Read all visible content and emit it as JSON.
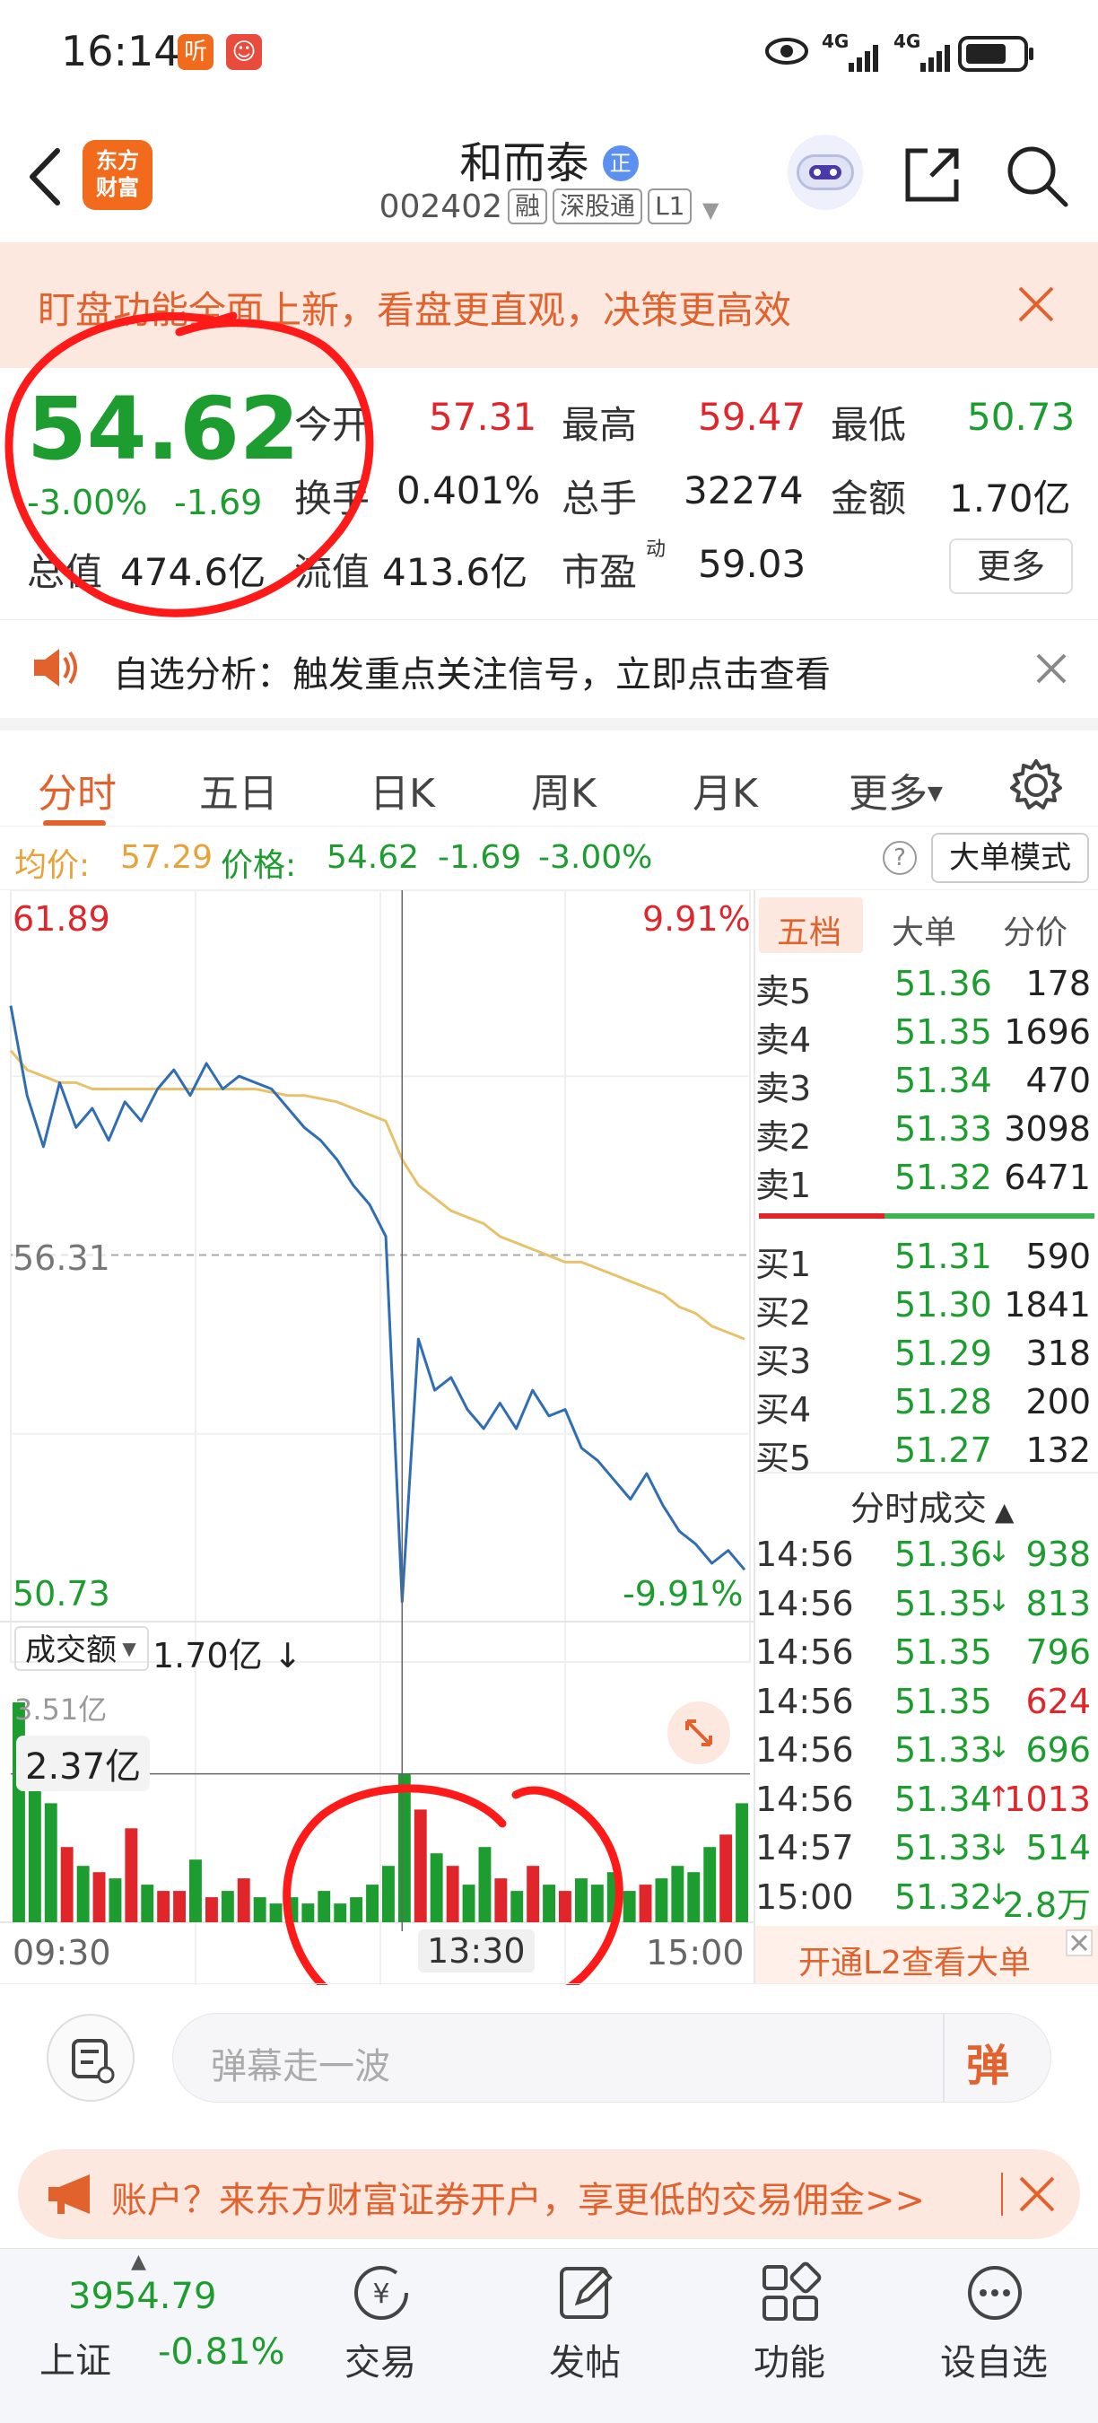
{
  "status_bar": {
    "time": "16:14",
    "badge1": "听",
    "net1": "4G",
    "net2": "4G"
  },
  "header": {
    "title": "和而泰",
    "title_badge": "正",
    "code": "002402",
    "tags": [
      "融",
      "深股通",
      "L1"
    ],
    "logo_line1": "东方",
    "logo_line2": "财富"
  },
  "banner": {
    "text": "盯盘功能全面上新，看盘更直观，决策更高效"
  },
  "quote": {
    "price": "54.62",
    "change_pct": "-3.00%",
    "change_amt": "-1.69",
    "total_value_label": "总值",
    "total_value": "474.6亿",
    "open_label": "今开",
    "open": "57.31",
    "high_label": "最高",
    "high": "59.47",
    "low_label": "最低",
    "low": "50.73",
    "turnover_label": "换手",
    "turnover": "0.401%",
    "volume_label": "总手",
    "volume": "32274",
    "amount_label": "金额",
    "amount": "1.70亿",
    "float_label": "流值",
    "float_value": "413.6亿",
    "pe_label": "市盈",
    "pe_sup": "动",
    "pe": "59.03",
    "more": "更多"
  },
  "analysis": {
    "text": "自选分析：触发重点关注信号，立即点击查看"
  },
  "tabs": [
    "分时",
    "五日",
    "日K",
    "周K",
    "月K",
    "更多"
  ],
  "info": {
    "avg_label": "均价:",
    "avg": "57.29",
    "price_label": "价格:",
    "price": "54.62",
    "chg": "-1.69",
    "pct": "-3.00%",
    "help": "?",
    "big_mode": "大单模式"
  },
  "chart_labels": {
    "top_price": "61.89",
    "top_pct": "9.91%",
    "mid_price": "56.31",
    "bottom_price": "50.73",
    "bottom_pct": "-9.91%",
    "vol_label": "成交额",
    "vol_value": "1.70亿",
    "vol_max": "3.51亿",
    "vol_cursor": "2.37亿",
    "t_start": "09:30",
    "t_mid": "13:30",
    "t_end": "15:00"
  },
  "chart_data": {
    "type": "line",
    "x_range": [
      "09:30",
      "15:00"
    ],
    "ylim": [
      50.73,
      61.89
    ],
    "ref_price": 56.31,
    "series": [
      {
        "name": "价格",
        "values": [
          60.2,
          58.8,
          58.0,
          59.0,
          58.3,
          58.6,
          58.1,
          58.7,
          58.4,
          58.9,
          59.2,
          58.8,
          59.3,
          58.9,
          59.1,
          59.0,
          58.9,
          58.6,
          58.3,
          58.1,
          57.8,
          57.4,
          57.1,
          56.6,
          50.9,
          55.0,
          54.2,
          54.4,
          53.9,
          53.6,
          54.0,
          53.6,
          54.2,
          53.8,
          53.9,
          53.3,
          53.1,
          52.8,
          52.5,
          52.9,
          52.4,
          52.0,
          51.8,
          51.5,
          51.7,
          51.4
        ]
      },
      {
        "name": "均价",
        "values": [
          59.5,
          59.2,
          59.1,
          59.0,
          59.0,
          58.9,
          58.9,
          58.9,
          58.9,
          58.9,
          58.9,
          58.9,
          58.9,
          58.9,
          58.9,
          58.9,
          58.85,
          58.8,
          58.8,
          58.75,
          58.7,
          58.6,
          58.5,
          58.4,
          57.8,
          57.4,
          57.2,
          57.0,
          56.9,
          56.8,
          56.6,
          56.5,
          56.4,
          56.3,
          56.2,
          56.2,
          56.1,
          56.0,
          55.9,
          55.8,
          55.7,
          55.5,
          55.4,
          55.2,
          55.1,
          55.0
        ]
      }
    ],
    "volume_max": "3.51亿",
    "volume": [
      3.51,
      2.4,
      1.9,
      1.2,
      0.9,
      0.8,
      0.7,
      1.5,
      0.6,
      0.5,
      0.5,
      1.0,
      0.4,
      0.5,
      0.7,
      0.4,
      0.3,
      0.4,
      0.3,
      0.5,
      0.3,
      0.4,
      0.6,
      0.9,
      2.37,
      1.8,
      1.1,
      0.9,
      0.6,
      1.2,
      0.7,
      0.5,
      0.9,
      0.6,
      0.5,
      0.7,
      0.6,
      0.8,
      0.5,
      0.6,
      0.7,
      0.9,
      0.8,
      1.2,
      1.4,
      1.9
    ]
  },
  "order_book": {
    "tabs": [
      "五档",
      "大单",
      "分价"
    ],
    "asks": [
      {
        "label": "卖5",
        "price": "51.36",
        "vol": "178"
      },
      {
        "label": "卖4",
        "price": "51.35",
        "vol": "1696"
      },
      {
        "label": "卖3",
        "price": "51.34",
        "vol": "470"
      },
      {
        "label": "卖2",
        "price": "51.33",
        "vol": "3098"
      },
      {
        "label": "卖1",
        "price": "51.32",
        "vol": "6471"
      }
    ],
    "bids": [
      {
        "label": "买1",
        "price": "51.31",
        "vol": "590"
      },
      {
        "label": "买2",
        "price": "51.30",
        "vol": "1841"
      },
      {
        "label": "买3",
        "price": "51.29",
        "vol": "318"
      },
      {
        "label": "买4",
        "price": "51.28",
        "vol": "200"
      },
      {
        "label": "买5",
        "price": "51.27",
        "vol": "132"
      }
    ]
  },
  "trades": {
    "title": "分时成交",
    "rows": [
      {
        "time": "14:56",
        "price": "51.36",
        "dir": "↓",
        "vol": "938",
        "color": "#1d9d2f"
      },
      {
        "time": "14:56",
        "price": "51.35",
        "dir": "↓",
        "vol": "813",
        "color": "#1d9d2f"
      },
      {
        "time": "14:56",
        "price": "51.35",
        "dir": "",
        "vol": "796",
        "color": "#1d9d2f"
      },
      {
        "time": "14:56",
        "price": "51.35",
        "dir": "",
        "vol": "624",
        "color": "#e0262b"
      },
      {
        "time": "14:56",
        "price": "51.33",
        "dir": "↓",
        "vol": "696",
        "color": "#1d9d2f"
      },
      {
        "time": "14:56",
        "price": "51.34",
        "dir": "↑",
        "vol": "1013",
        "color": "#e0262b"
      },
      {
        "time": "14:57",
        "price": "51.33",
        "dir": "↓",
        "vol": "514",
        "color": "#1d9d2f"
      },
      {
        "time": "15:00",
        "price": "51.32",
        "dir": "↓",
        "vol": "2.8万",
        "color": "#1d9d2f"
      }
    ],
    "l2": "开通L2查看大单"
  },
  "comment": {
    "placeholder": "弹幕走一波",
    "send": "弹"
  },
  "ad": {
    "text": "账户？来东方财富证券开户，享更低的交易佣金>>"
  },
  "bottom_nav": {
    "index_value": "3954.79",
    "index_name": "上证",
    "index_pct": "-0.81%",
    "items": [
      "交易",
      "发帖",
      "功能",
      "设自选"
    ]
  },
  "colors": {
    "up": "#e0262b",
    "down": "#1d9d2f",
    "accent": "#e2622e",
    "avg_line": "#e8c26a",
    "price_line": "#2f6db5",
    "annotation": "#ff1a1a"
  }
}
